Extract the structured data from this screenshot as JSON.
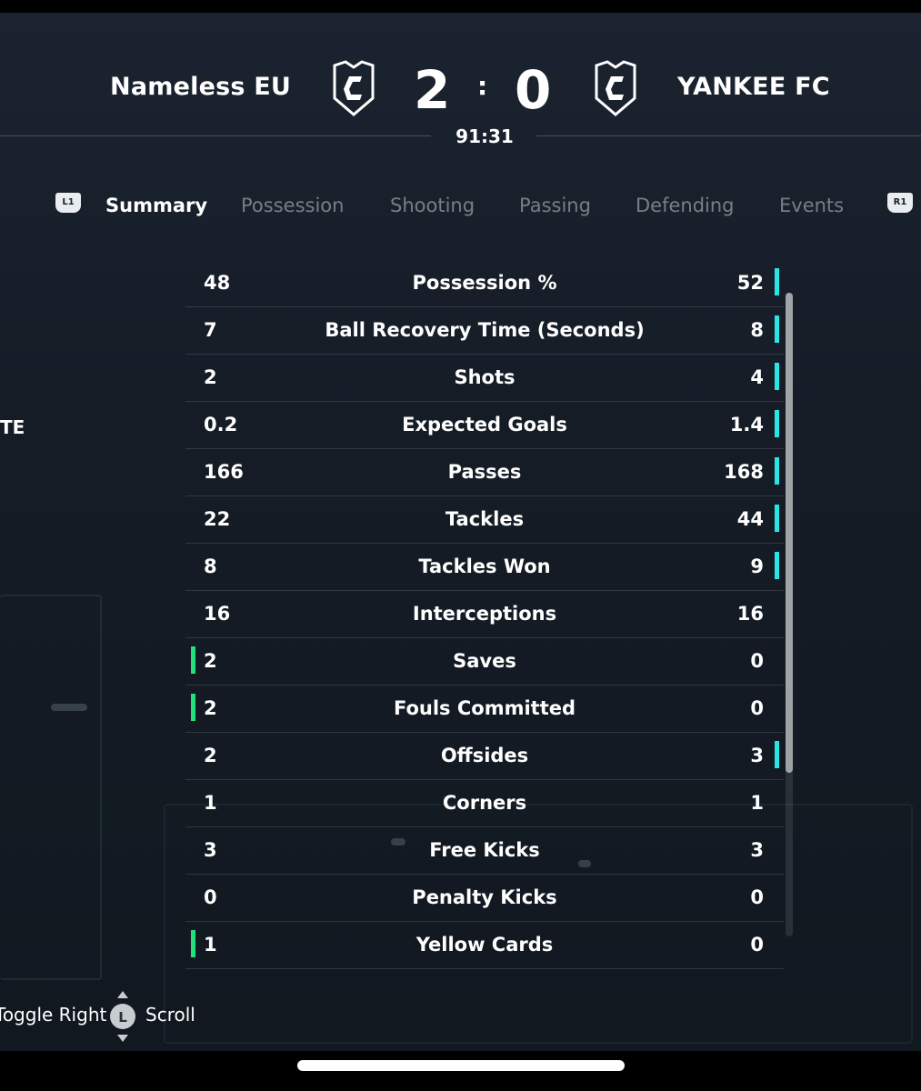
{
  "header": {
    "home_team": "Nameless EU",
    "away_team": "YANKEE FC",
    "home_score": "2",
    "away_score": "0",
    "separator": ":",
    "clock": "91:31"
  },
  "tabs": {
    "left_shoulder": "L1",
    "right_shoulder": "R1",
    "items": [
      "Summary",
      "Possession",
      "Shooting",
      "Passing",
      "Defending",
      "Events"
    ],
    "active": "Summary"
  },
  "side_peek": "TE",
  "stats": [
    {
      "label": "Possession %",
      "home": "48",
      "away": "52",
      "leader": "away"
    },
    {
      "label": "Ball Recovery Time (Seconds)",
      "home": "7",
      "away": "8",
      "leader": "away"
    },
    {
      "label": "Shots",
      "home": "2",
      "away": "4",
      "leader": "away"
    },
    {
      "label": "Expected Goals",
      "home": "0.2",
      "away": "1.4",
      "leader": "away"
    },
    {
      "label": "Passes",
      "home": "166",
      "away": "168",
      "leader": "away"
    },
    {
      "label": "Tackles",
      "home": "22",
      "away": "44",
      "leader": "away"
    },
    {
      "label": "Tackles Won",
      "home": "8",
      "away": "9",
      "leader": "away"
    },
    {
      "label": "Interceptions",
      "home": "16",
      "away": "16",
      "leader": "none"
    },
    {
      "label": "Saves",
      "home": "2",
      "away": "0",
      "leader": "home"
    },
    {
      "label": "Fouls Committed",
      "home": "2",
      "away": "0",
      "leader": "home"
    },
    {
      "label": "Offsides",
      "home": "2",
      "away": "3",
      "leader": "away"
    },
    {
      "label": "Corners",
      "home": "1",
      "away": "1",
      "leader": "none"
    },
    {
      "label": "Free Kicks",
      "home": "3",
      "away": "3",
      "leader": "none"
    },
    {
      "label": "Penalty Kicks",
      "home": "0",
      "away": "0",
      "leader": "none"
    },
    {
      "label": "Yellow Cards",
      "home": "1",
      "away": "0",
      "leader": "home"
    }
  ],
  "colors": {
    "home_leader_bar": "#21e07a",
    "away_leader_bar": "#29e6e6",
    "background": "#151c26"
  },
  "footer": {
    "toggle_hint": "Toggle Right",
    "stick_label": "L",
    "scroll_hint": "Scroll"
  },
  "icons": [
    "club-crest-icon",
    "left-stick-icon",
    "l1-shoulder-icon",
    "r1-shoulder-icon"
  ]
}
